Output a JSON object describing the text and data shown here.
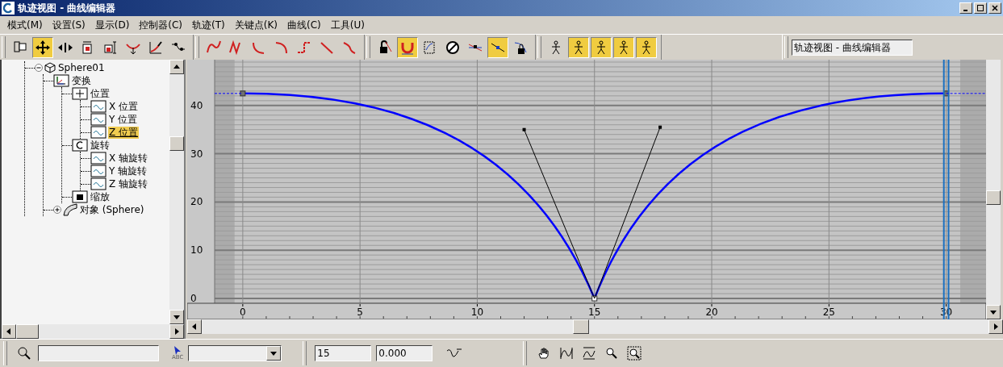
{
  "window": {
    "title": "轨迹视图 - 曲线编辑器"
  },
  "menu": [
    "模式(M)",
    "设置(S)",
    "显示(D)",
    "控制器(C)",
    "轨迹(T)",
    "关键点(K)",
    "曲线(C)",
    "工具(U)"
  ],
  "toolbar": [
    {
      "buttons": [
        {
          "kind": "filter",
          "selected": false
        },
        {
          "kind": "move",
          "selected": true
        },
        {
          "kind": "slide",
          "selected": false
        },
        {
          "kind": "scale-time",
          "selected": false
        },
        {
          "kind": "scale-values",
          "selected": false
        },
        {
          "kind": "add-key",
          "selected": false
        },
        {
          "kind": "draw",
          "selected": false
        },
        {
          "kind": "reduce",
          "selected": false
        }
      ]
    },
    {
      "buttons": [
        {
          "kind": "tangent-auto",
          "selected": false
        },
        {
          "kind": "tangent-custom",
          "selected": false
        },
        {
          "kind": "tangent-fast",
          "selected": false
        },
        {
          "kind": "tangent-slow",
          "selected": false
        },
        {
          "kind": "tangent-step",
          "selected": false
        },
        {
          "kind": "tangent-linear",
          "selected": false
        },
        {
          "kind": "tangent-smooth",
          "selected": false
        }
      ]
    },
    {
      "buttons": [
        {
          "kind": "lock",
          "selected": false
        },
        {
          "kind": "snap",
          "selected": true
        },
        {
          "kind": "params",
          "selected": false
        },
        {
          "kind": "no-ease",
          "selected": false
        },
        {
          "kind": "show-keys",
          "selected": false
        },
        {
          "kind": "show-tangents",
          "selected": true
        },
        {
          "kind": "lock-tangents",
          "selected": false
        }
      ]
    },
    {
      "buttons": [
        {
          "kind": "biped",
          "selected": false
        },
        {
          "kind": "biped",
          "selected": true
        },
        {
          "kind": "biped",
          "selected": true
        },
        {
          "kind": "biped",
          "selected": true
        },
        {
          "kind": "biped",
          "selected": true
        }
      ]
    }
  ],
  "name_field": {
    "value": "轨迹视图 - 曲线编辑器"
  },
  "tree": [
    {
      "label": "Sphere01",
      "kind": "object",
      "expanded": true,
      "selected": false,
      "children": [
        {
          "label": "变换",
          "kind": "transform",
          "selected": false,
          "children": [
            {
              "label": "位置",
              "kind": "position",
              "selected": false,
              "children": [
                {
                  "label": "X 位置",
                  "kind": "curve",
                  "selected": false
                },
                {
                  "label": "Y 位置",
                  "kind": "curve",
                  "selected": false
                },
                {
                  "label": "Z 位置",
                  "kind": "curve",
                  "selected": true
                }
              ]
            },
            {
              "label": "旋转",
              "kind": "rotation",
              "selected": false,
              "children": [
                {
                  "label": "X 轴旋转",
                  "kind": "curve",
                  "selected": false
                },
                {
                  "label": "Y 轴旋转",
                  "kind": "curve",
                  "selected": false
                },
                {
                  "label": "Z 轴旋转",
                  "kind": "curve",
                  "selected": false
                }
              ]
            },
            {
              "label": "缩放",
              "kind": "scale",
              "selected": false
            }
          ]
        },
        {
          "label": "对象 (Sphere)",
          "kind": "shape",
          "expanded": false,
          "selected": false
        }
      ]
    }
  ],
  "graph": {
    "chart_data": {
      "type": "line",
      "x": [
        0,
        15,
        30
      ],
      "series": [
        {
          "color": "#0000ff",
          "marker": "square",
          "values": [
            42.5,
            0,
            42.5
          ]
        }
      ],
      "bands": [
        {
          "axis": "x",
          "from": -1.2,
          "to": -0.35
        },
        {
          "axis": "x",
          "from": 30.6,
          "to": 31.7
        }
      ],
      "ref_lines": [
        {
          "axis": "x",
          "value": 29.9,
          "color": "#1a6fbf"
        },
        {
          "axis": "x",
          "value": 30.1,
          "color": "#1a6fbf"
        }
      ],
      "xlim": [
        -1.2,
        31.7
      ],
      "ylim": [
        -1,
        49.5
      ],
      "grid": true,
      "xticks": [
        0,
        5,
        10,
        15,
        20,
        25,
        30
      ],
      "yticks": [
        0,
        10,
        20,
        30,
        40
      ]
    }
  },
  "bottom": {
    "select_label": "ABC",
    "frame": "15",
    "value": "0.000"
  }
}
